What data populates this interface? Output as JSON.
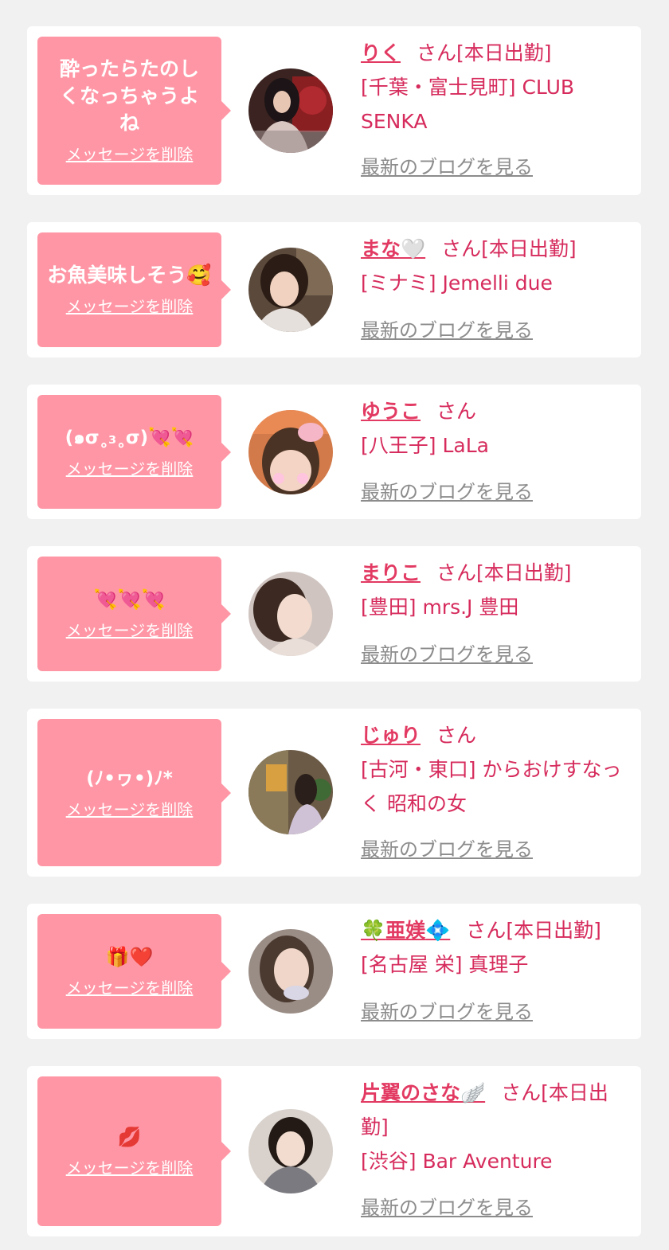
{
  "colors": {
    "page_background": "#f1f1f1",
    "card_background": "#ffffff",
    "bubble": "#ff96a5",
    "name_pink": "#e23a62",
    "info_pink": "#d62b5c",
    "blog_gray": "#8c8c8c"
  },
  "common": {
    "delete_label": "メッセージを削除",
    "blog_label": "最新のブログを見る",
    "san_suffix": "さん"
  },
  "entries": [
    {
      "message": "酔ったらたのしくなっちゃうよね",
      "name": "りく",
      "status": "[本日出勤]",
      "shop": "[千葉・富士見町] CLUB SENKA",
      "avatar_icon": "woman-photo-icon"
    },
    {
      "message": "お魚美味しそう🥰",
      "name": "まな🤍",
      "status": "[本日出勤]",
      "shop": "[ミナミ] Jemelli due",
      "avatar_icon": "woman-photo-icon"
    },
    {
      "message": "(๑σ˳₃˳σ)💘💘",
      "name": "ゆうこ",
      "status": "",
      "shop": "[八王子] LaLa",
      "avatar_icon": "woman-photo-icon"
    },
    {
      "message": "💘💘💘",
      "name": "まりこ",
      "status": "[本日出勤]",
      "shop": "[豊田] mrs.J 豊田",
      "avatar_icon": "woman-photo-icon"
    },
    {
      "message": "(ﾉ•ヮ•)ﾉ*",
      "name": "じゅり",
      "status": "",
      "shop": "[古河・東口] からおけすなっく 昭和の女",
      "avatar_icon": "woman-photo-icon"
    },
    {
      "message": "🎁❤️",
      "name_parts": [
        "🍀",
        "亜媄",
        "💠"
      ],
      "status": "[本日出勤]",
      "shop": "[名古屋 栄] 真理子",
      "avatar_icon": "woman-photo-icon"
    },
    {
      "message": "💋",
      "name": "片翼のさな🪽",
      "status": "[本日出勤]",
      "shop": "[渋谷] Bar Aventure",
      "avatar_icon": "woman-photo-icon"
    }
  ]
}
